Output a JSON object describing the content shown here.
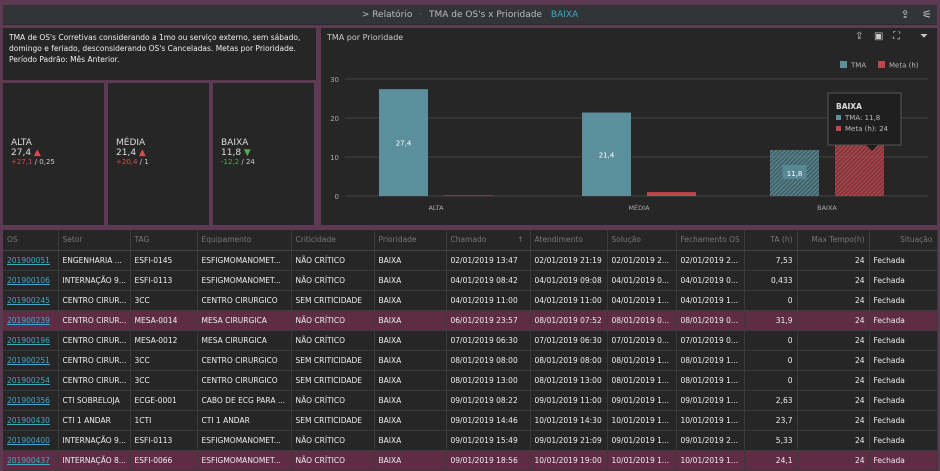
{
  "header": {
    "crumb_prefix": ">",
    "crumb_parent": "Relatório",
    "crumb_report": "TMA de OS's x Prioridade",
    "crumb_current": "BAIXA"
  },
  "description": "TMA de OS's Corretivas considerando a 1mo ou serviço externo, sem sábado, domingo e feriado, desconsiderando OS's Canceladas. Metas por Prioridade. Período Padrão: Mês Anterior.",
  "kpis": [
    {
      "label": "ALTA",
      "value": "27,4",
      "trend": "up",
      "delta": "+27,1",
      "target": "0,25"
    },
    {
      "label": "MÉDIA",
      "value": "21,4",
      "trend": "up",
      "delta": "+20,4",
      "target": "1"
    },
    {
      "label": "BAIXA",
      "value": "11,8",
      "trend": "down",
      "delta": "-12,2",
      "target": "24"
    }
  ],
  "colors": {
    "tma": "#5b8f9b",
    "meta": "#c0464e",
    "highlight": "#5e2d45",
    "link": "#3fa8c8",
    "frame": "#5b3a52"
  },
  "chart_data": {
    "type": "bar",
    "title": "TMA por Prioridade",
    "categories": [
      "ALTA",
      "MÉDIA",
      "BAIXA"
    ],
    "series": [
      {
        "name": "TMA",
        "values": [
          27.4,
          21.4,
          11.8
        ],
        "labels": [
          "27,4",
          "21,4",
          "11,8"
        ]
      },
      {
        "name": "Meta (h)",
        "values": [
          0.25,
          1,
          24
        ]
      }
    ],
    "ylim": [
      0,
      30
    ],
    "yticks": [
      "0",
      "10",
      "20",
      "30"
    ],
    "grid": true,
    "legend": "top-right",
    "selected": "BAIXA",
    "tooltip": {
      "title": "BAIXA",
      "lines": [
        "TMA: 11,8",
        "Meta (h): 24"
      ]
    }
  },
  "table": {
    "columns": [
      "OS",
      "Setor",
      "TAG",
      "Equipamento",
      "Criticidade",
      "Prioridade",
      "Chamado",
      "Atendimento",
      "Solução",
      "Fechamento OS",
      "TA (h)",
      "Max Tempo(h)",
      "Situação"
    ],
    "sort_indicator": "↑",
    "rows": [
      {
        "hl": false,
        "c": [
          "201900051",
          "ENGENHARIA ...",
          "ESFI-0145",
          "ESFIGMOMANOMET...",
          "NÃO CRÍTICO",
          "BAIXA",
          "02/01/2019 13:47",
          "02/01/2019 21:19",
          "02/01/2019 2...",
          "02/01/2019 2...",
          "7,53",
          "24",
          "Fechada"
        ]
      },
      {
        "hl": false,
        "c": [
          "201900106",
          "INTERNAÇÃO 9...",
          "ESFI-0113",
          "ESFIGMOMANOMET...",
          "NÃO CRÍTICO",
          "BAIXA",
          "04/01/2019 08:42",
          "04/01/2019 09:08",
          "04/01/2019 0...",
          "04/01/2019 0...",
          "0,433",
          "24",
          "Fechada"
        ]
      },
      {
        "hl": false,
        "c": [
          "201900245",
          "CENTRO CIRUR...",
          "3CC",
          "CENTRO CIRURGICO",
          "SEM CRITICIDADE",
          "BAIXA",
          "04/01/2019 11:00",
          "04/01/2019 11:00",
          "04/01/2019 1...",
          "04/01/2019 1...",
          "0",
          "24",
          "Fechada"
        ]
      },
      {
        "hl": true,
        "c": [
          "201900239",
          "CENTRO CIRUR...",
          "MESA-0014",
          "MESA CIRURGICA",
          "NÃO CRÍTICO",
          "BAIXA",
          "06/01/2019 23:57",
          "08/01/2019 07:52",
          "08/01/2019 0...",
          "08/01/2019 0...",
          "31,9",
          "24",
          "Fechada"
        ]
      },
      {
        "hl": false,
        "c": [
          "201900196",
          "CENTRO CIRUR...",
          "MESA-0012",
          "MESA CIRURGICA",
          "NÃO CRÍTICO",
          "BAIXA",
          "07/01/2019 06:30",
          "07/01/2019 06:30",
          "07/01/2019 0...",
          "07/01/2019 0...",
          "0",
          "24",
          "Fechada"
        ]
      },
      {
        "hl": false,
        "c": [
          "201900251",
          "CENTRO CIRUR...",
          "3CC",
          "CENTRO CIRURGICO",
          "SEM CRITICIDADE",
          "BAIXA",
          "08/01/2019 08:00",
          "08/01/2019 08:00",
          "08/01/2019 1...",
          "08/01/2019 1...",
          "0",
          "24",
          "Fechada"
        ]
      },
      {
        "hl": false,
        "c": [
          "201900254",
          "CENTRO CIRUR...",
          "3CC",
          "CENTRO CIRURGICO",
          "SEM CRITICIDADE",
          "BAIXA",
          "08/01/2019 13:00",
          "08/01/2019 13:00",
          "08/01/2019 1...",
          "08/01/2019 1...",
          "0",
          "24",
          "Fechada"
        ]
      },
      {
        "hl": false,
        "c": [
          "201900356",
          "CTI SOBRELOJA",
          "ECGE-0001",
          "CABO DE ECG PARA ...",
          "NÃO CRÍTICO",
          "BAIXA",
          "09/01/2019 08:22",
          "09/01/2019 11:00",
          "09/01/2019 1...",
          "09/01/2019 1...",
          "2,63",
          "24",
          "Fechada"
        ]
      },
      {
        "hl": false,
        "c": [
          "201900430",
          "CTI 1 ANDAR",
          "1CTI",
          "CTI 1 ANDAR",
          "SEM CRITICIDADE",
          "BAIXA",
          "09/01/2019 14:46",
          "10/01/2019 14:30",
          "10/01/2019 1...",
          "10/01/2019 1...",
          "23,7",
          "24",
          "Fechada"
        ]
      },
      {
        "hl": false,
        "c": [
          "201900400",
          "INTERNAÇÃO 9...",
          "ESFI-0113",
          "ESFIGMOMANOMET...",
          "NÃO CRÍTICO",
          "BAIXA",
          "09/01/2019 15:49",
          "09/01/2019 21:09",
          "09/01/2019 1...",
          "09/01/2019 2...",
          "5,33",
          "24",
          "Fechada"
        ]
      },
      {
        "hl": true,
        "c": [
          "201900437",
          "INTERNAÇÃO 8...",
          "ESFI-0066",
          "ESFIGMOMANOMET...",
          "NÃO CRÍTICO",
          "BAIXA",
          "09/01/2019 18:56",
          "10/01/2019 19:00",
          "10/01/2019 1...",
          "10/01/2019 1...",
          "24,1",
          "24",
          "Fechada"
        ]
      }
    ]
  }
}
